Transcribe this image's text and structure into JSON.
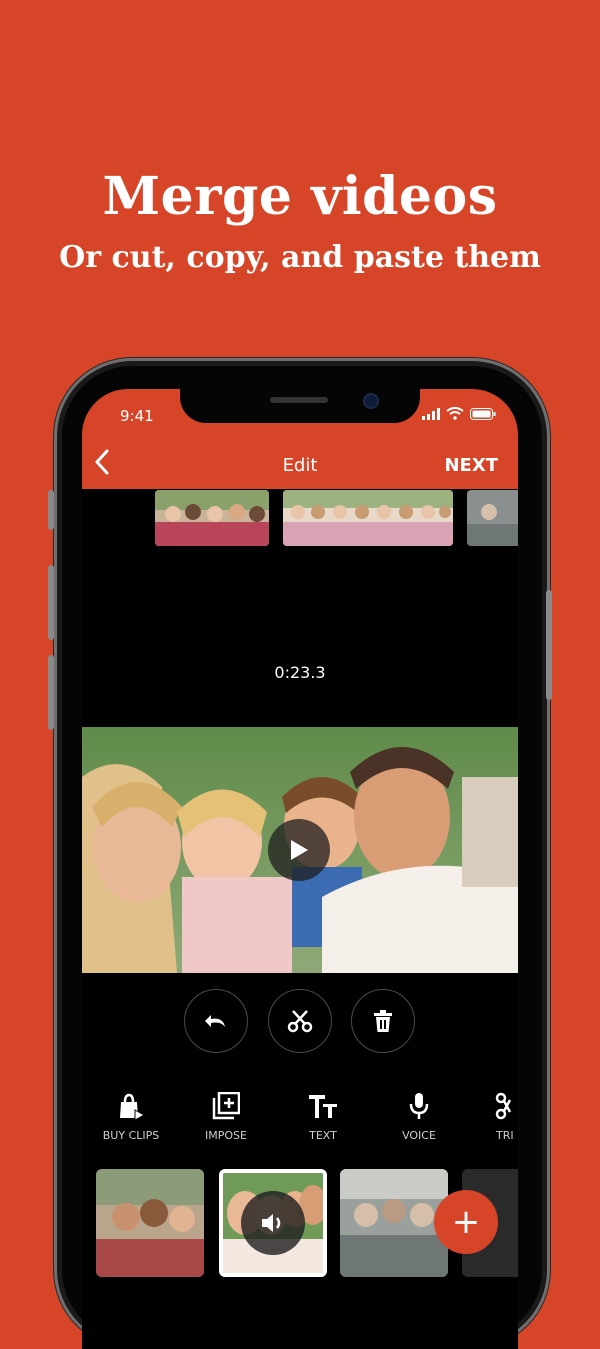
{
  "promo": {
    "headline": "Merge videos",
    "subline": "Or cut, copy, and paste them"
  },
  "status_bar": {
    "time": "9:41"
  },
  "nav": {
    "back_icon": "chevron-left-icon",
    "title": "Edit",
    "next_label": "NEXT"
  },
  "timeline": {
    "timecode": "0:23.3"
  },
  "preview": {
    "play_icon": "play-icon"
  },
  "edit_actions": [
    {
      "name": "undo",
      "icon": "undo-icon"
    },
    {
      "name": "cut",
      "icon": "scissors-icon"
    },
    {
      "name": "delete",
      "icon": "trash-icon"
    }
  ],
  "tools": [
    {
      "label": "BUY CLIPS",
      "icon": "shopping-bag-icon"
    },
    {
      "label": "IMPOSE",
      "icon": "impose-icon"
    },
    {
      "label": "TEXT",
      "icon": "text-icon"
    },
    {
      "label": "VOICE",
      "icon": "microphone-icon"
    },
    {
      "label": "TRI",
      "icon": "trim-icon"
    }
  ],
  "clips": {
    "selected_icon": "volume-icon",
    "add_label": "+"
  },
  "colors": {
    "brand": "#D64527",
    "screen_bg": "#000000"
  }
}
